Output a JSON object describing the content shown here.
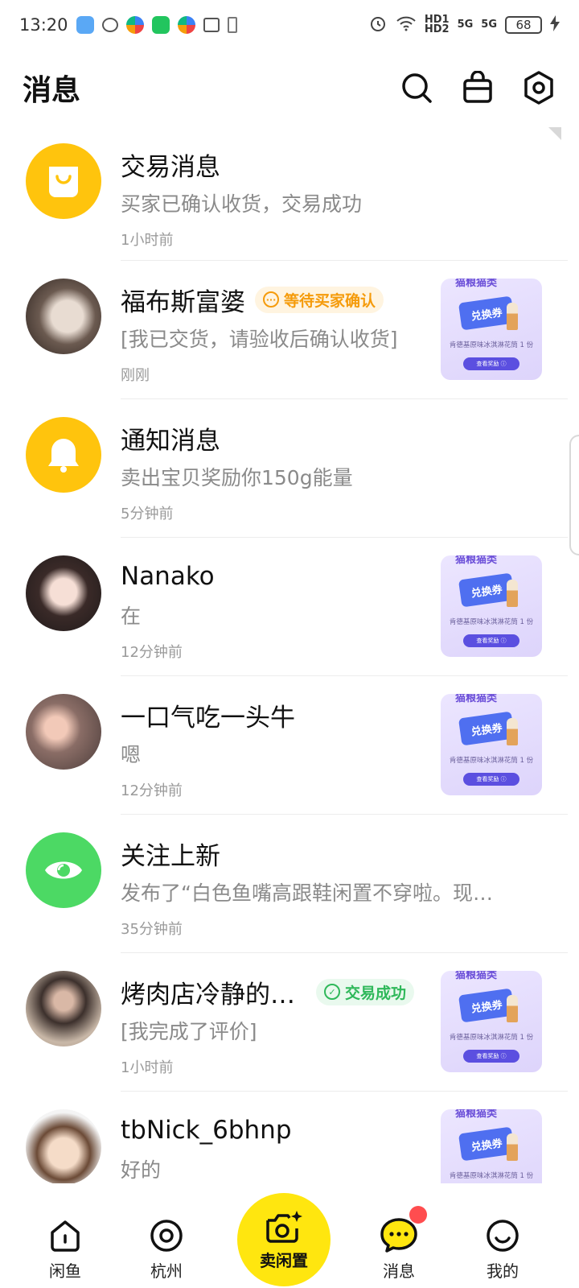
{
  "status_bar": {
    "time": "13:20",
    "hd1": "HD1",
    "hd2": "HD2",
    "net1": "5G",
    "net2": "5G",
    "battery": "68"
  },
  "header": {
    "title": "消息",
    "icons": [
      "search-icon",
      "shop-bag-icon",
      "settings-icon"
    ]
  },
  "colors": {
    "accent_yellow": "#ffe60f",
    "avatar_yellow": "#ffc40d",
    "avatar_green": "#4cd964",
    "badge_orange": "#f59b0b",
    "badge_green": "#2fb85a",
    "notification_red": "#ff4d4f"
  },
  "messages": [
    {
      "title": "交易消息",
      "preview": "买家已确认收货，交易成功",
      "time": "1小时前"
    },
    {
      "title": "福布斯富婆",
      "badge": "等待买家确认",
      "preview": "[我已交货，请验收后确认收货]",
      "time": "刚刚"
    },
    {
      "title": "通知消息",
      "preview": "卖出宝贝奖励你150g能量",
      "time": "5分钟前"
    },
    {
      "title": "Nanako",
      "preview": "在",
      "time": "12分钟前"
    },
    {
      "title": "一口气吃一头牛",
      "preview": "嗯",
      "time": "12分钟前"
    },
    {
      "title": "关注上新",
      "preview": "发布了“白色鱼嘴高跟鞋闲置不穿啦。现…",
      "time": "35分钟前"
    },
    {
      "title": "烤肉店冷静的…",
      "badge": "交易成功",
      "preview": "[我完成了评价]",
      "time": "1小时前"
    },
    {
      "title": "tbNick_6bhnp",
      "preview": "好的",
      "time": ""
    }
  ],
  "voucher": {
    "header": "猫粮猫类",
    "ticket": "兑换券",
    "text": "肯德基原味冰淇淋花筒 1 份",
    "button": "查看奖励 ⓘ"
  },
  "tab_bar": {
    "home": "闲鱼",
    "city": "杭州",
    "sell": "卖闲置",
    "messages": "消息",
    "me": "我的"
  }
}
